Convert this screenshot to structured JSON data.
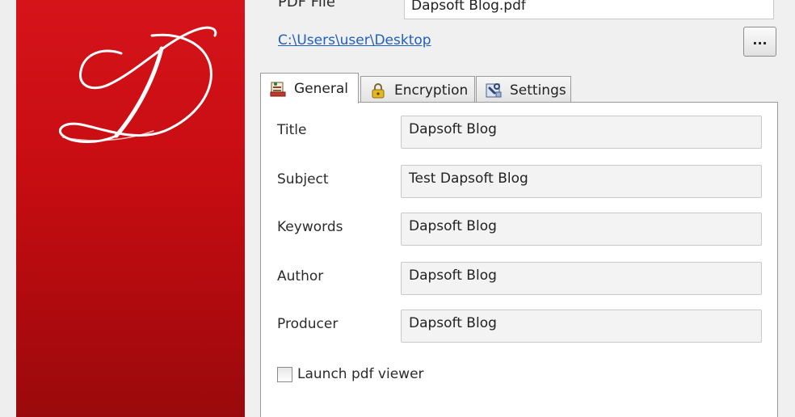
{
  "header": {
    "pdf_file_label": "PDF File",
    "pdf_file_value": "Dapsoft Blog.pdf",
    "output_path": "C:\\Users\\user\\Desktop",
    "browse_label": "..."
  },
  "tabs": [
    {
      "label": "General",
      "icon": "document-icon",
      "active": true
    },
    {
      "label": "Encryption",
      "icon": "padlock-icon",
      "active": false
    },
    {
      "label": "Settings",
      "icon": "settings-icon",
      "active": false
    }
  ],
  "general": {
    "fields": [
      {
        "label": "Title",
        "value": "Dapsoft Blog"
      },
      {
        "label": "Subject",
        "value": "Test Dapsoft Blog"
      },
      {
        "label": "Keywords",
        "value": "Dapsoft Blog"
      },
      {
        "label": "Author",
        "value": "Dapsoft Blog"
      },
      {
        "label": "Producer",
        "value": "Dapsoft Blog"
      }
    ],
    "launch_viewer_label": "Launch pdf viewer",
    "launch_viewer_checked": false
  },
  "colors": {
    "banner_red": "#c80d12",
    "link_blue": "#1f5fc0"
  }
}
